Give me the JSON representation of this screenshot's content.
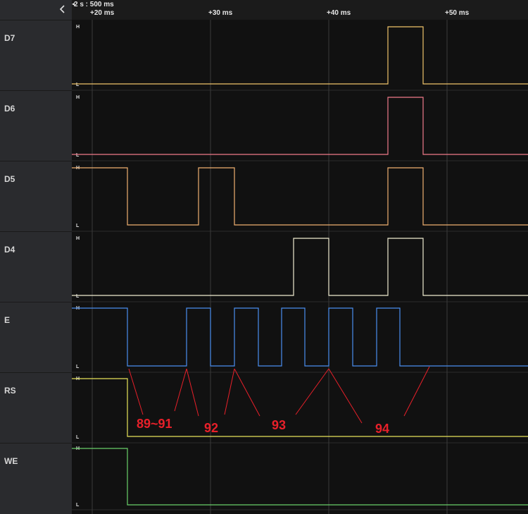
{
  "ruler": {
    "scale_label": "2 s : 500 ms",
    "ticks": [
      "+20 ms",
      "+30 ms",
      "+40 ms",
      "+50 ms"
    ]
  },
  "level_labels": {
    "high": "H",
    "low": "L"
  },
  "channels": [
    {
      "name": "D7",
      "color": "#f0c36a"
    },
    {
      "name": "D6",
      "color": "#f07a8a"
    },
    {
      "name": "D5",
      "color": "#f0b070"
    },
    {
      "name": "D4",
      "color": "#f0ecd0"
    },
    {
      "name": "E",
      "color": "#4a8ef0"
    },
    {
      "name": "RS",
      "color": "#e8e45a"
    },
    {
      "name": "WE",
      "color": "#6ad06a"
    }
  ],
  "annotations": {
    "color": "#e8202a",
    "labels": [
      "89~91",
      "92",
      "93",
      "94"
    ]
  }
}
